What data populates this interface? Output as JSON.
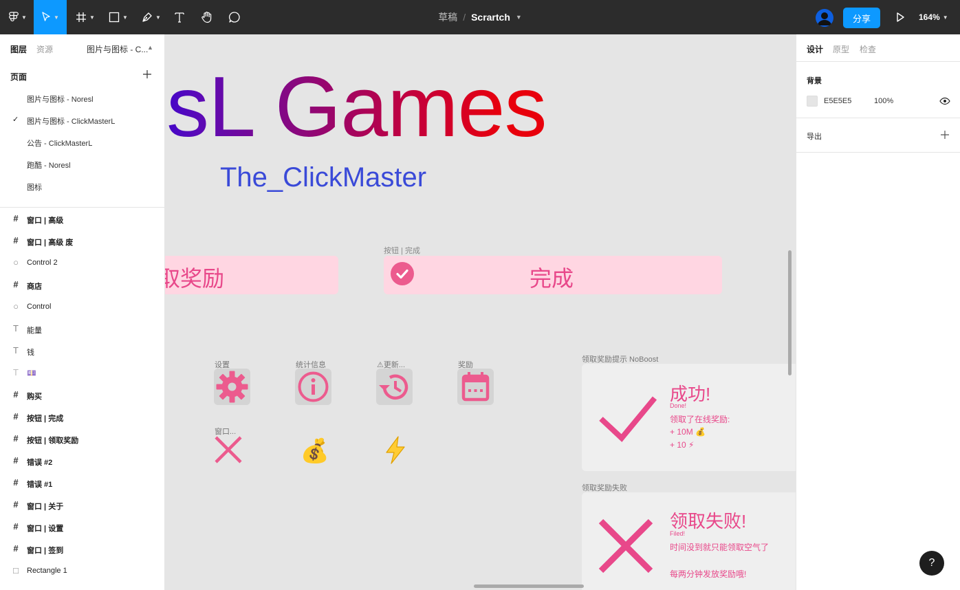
{
  "toolbar": {
    "breadcrumb_draft": "草稿",
    "breadcrumb_sep": "/",
    "file_name": "Scrartch",
    "share_label": "分享",
    "zoom_label": "164%"
  },
  "left_panel": {
    "tab_layers": "图层",
    "tab_assets": "资源",
    "current_page": "图片与图标 - C...",
    "pages_title": "页面",
    "pages": [
      {
        "label": "图片与图标 - Noresl",
        "checked": false
      },
      {
        "label": "图片与图标 - ClickMasterL",
        "checked": true
      },
      {
        "label": "公告 - ClickMasterL",
        "checked": false
      },
      {
        "label": "跑酷 - Noresl",
        "checked": false
      },
      {
        "label": "图标",
        "checked": false
      }
    ],
    "layers": [
      {
        "icon": "frame-icon",
        "label": "窗口 | 高级"
      },
      {
        "icon": "frame-icon",
        "label": "窗口 | 高级 废"
      },
      {
        "icon": "ellipse-icon",
        "label": "Control 2"
      },
      {
        "icon": "frame-icon",
        "label": "商店"
      },
      {
        "icon": "ellipse-icon",
        "label": "Control"
      },
      {
        "icon": "text-icon",
        "label": "能量"
      },
      {
        "icon": "text-icon",
        "label": "钱"
      },
      {
        "icon": "text-icon",
        "label": "💷"
      },
      {
        "icon": "frame-icon",
        "label": "购买"
      },
      {
        "icon": "frame-icon",
        "label": "按钮 | 完成"
      },
      {
        "icon": "frame-icon",
        "label": "按钮 | 领取奖励"
      },
      {
        "icon": "frame-icon",
        "label": "错误 #2"
      },
      {
        "icon": "frame-icon",
        "label": "错误 #1"
      },
      {
        "icon": "frame-icon",
        "label": "窗口 | 关于"
      },
      {
        "icon": "frame-icon",
        "label": "窗口 | 设置"
      },
      {
        "icon": "frame-icon",
        "label": "窗口 | 签到"
      },
      {
        "icon": "rectangle-icon",
        "label": "Rectangle 1"
      }
    ]
  },
  "canvas": {
    "big_title": "esL Games",
    "subtitle": "The_ClickMaster",
    "claim_button_text": "取奖励",
    "done_button_label": "按钮 | 完成",
    "done_button_text": "完成",
    "icons": [
      {
        "label": "设置",
        "icon": "gear-icon"
      },
      {
        "label": "统计信息",
        "icon": "info-icon"
      },
      {
        "label": "⚠更新...",
        "icon": "history-icon"
      },
      {
        "label": "奖励",
        "icon": "calendar-icon"
      },
      {
        "label": "窗口...",
        "icon": "close-x-icon"
      }
    ],
    "emoji_money": "💰",
    "emoji_bolt": "⚡",
    "success_card": {
      "label": "领取奖励提示 NoBoost",
      "title": "成功!",
      "sub": "Done!",
      "line1": "领取了在线奖励:",
      "line2": "+ 10M 💰",
      "line3": "+ 10   ⚡"
    },
    "fail_card": {
      "label": "领取奖励失败",
      "title": "领取失败!",
      "sub": "Filed!",
      "line1": "时间没到就只能领取空气了",
      "line2": "每两分钟发放奖励哦!"
    }
  },
  "right_panel": {
    "tab_design": "设计",
    "tab_prototype": "原型",
    "tab_inspect": "检查",
    "background_title": "背景",
    "background_hex": "E5E5E5",
    "background_opacity": "100%",
    "export_title": "导出"
  },
  "help_label": "?",
  "colors": {
    "accent": "#0d99ff",
    "pink": "#e8488a",
    "pink_bg": "#ffd6e2",
    "canvas_bg": "#e5e5e5"
  }
}
